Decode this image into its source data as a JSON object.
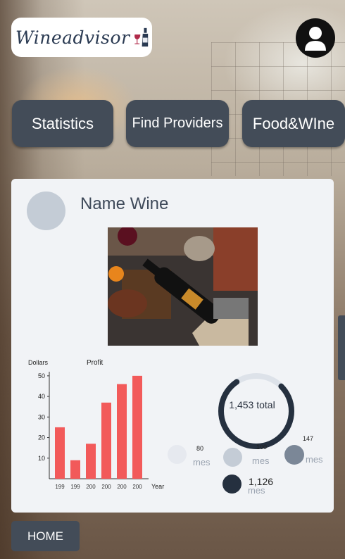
{
  "app": {
    "logo_text": "Wineadvisor"
  },
  "nav": {
    "statistics": "Statistics",
    "find_providers": "Find Providers",
    "food_wine": "Food&WIne"
  },
  "card": {
    "title": "Name Wine",
    "photo": "wine-bottle-photo"
  },
  "chart_data": {
    "type": "bar",
    "title": "Profit",
    "ylabel": "Dollars",
    "xlabel": "Year",
    "categories": [
      "199",
      "199",
      "200",
      "200",
      "200",
      "200"
    ],
    "values": [
      25,
      9,
      17,
      37,
      46,
      50
    ],
    "ylim": [
      0,
      52
    ],
    "yticks": [
      10,
      20,
      30,
      40,
      50
    ],
    "bar_color": "#f25a5a",
    "grid": false
  },
  "stats": {
    "total_label": "1,453 total",
    "total_progress_fraction": 0.78,
    "items": [
      {
        "value": "80",
        "unit": "mes",
        "color": "#e6e9ef"
      },
      {
        "value": "100",
        "unit": "mes",
        "color": "#c4ccd6"
      },
      {
        "value": "147",
        "unit": "mes",
        "color": "#7b8797"
      },
      {
        "value": "1,126",
        "unit": "mes",
        "color": "#25303f"
      }
    ]
  },
  "footer": {
    "home_label": "HOME"
  },
  "colors": {
    "button": "#434c58",
    "card": "#f1f3f6",
    "accent": "#f25a5a"
  }
}
